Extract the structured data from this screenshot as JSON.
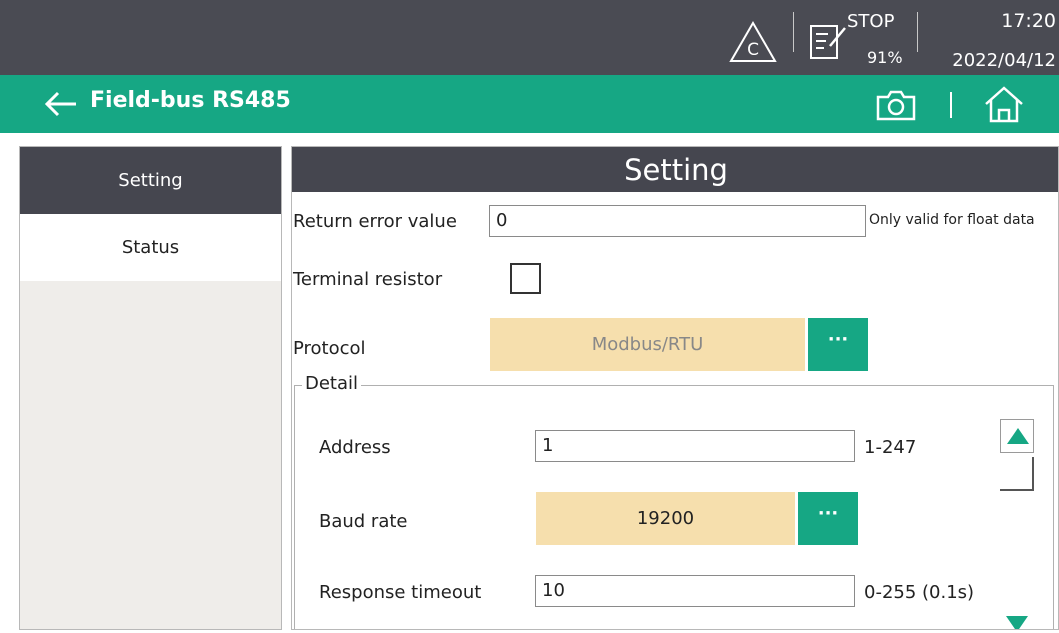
{
  "status_bar": {
    "state": "STOP",
    "battery": "91%",
    "time": "17:20",
    "date": "2022/04/12",
    "icons": [
      "alert-c-icon",
      "edit-note-icon"
    ]
  },
  "title_bar": {
    "title": "Field-bus RS485",
    "icons": [
      "back-arrow-icon",
      "camera-icon",
      "home-icon"
    ]
  },
  "sidebar": {
    "items": [
      {
        "label": "Setting",
        "selected": true
      },
      {
        "label": "Status",
        "selected": false
      }
    ]
  },
  "main": {
    "header": "Setting",
    "return_error": {
      "label": "Return error value",
      "value": "0",
      "hint": "Only valid for float data"
    },
    "terminal_resistor": {
      "label": "Terminal resistor",
      "checked": false
    },
    "protocol": {
      "label": "Protocol",
      "value": "Modbus/RTU",
      "more": "···"
    },
    "detail": {
      "title": "Detail",
      "address": {
        "label": "Address",
        "value": "1",
        "range": "1-247"
      },
      "baud_rate": {
        "label": "Baud rate",
        "value": "19200",
        "more": "···"
      },
      "response_timeout": {
        "label": "Response timeout",
        "value": "10",
        "range": "0-255 (0.1s)"
      }
    }
  },
  "colors": {
    "status_bar_bg": "#4a4b53",
    "accent_green": "#16a784",
    "header_dark": "#45464f",
    "select_bg": "#f6dfad",
    "sidebar_bg": "#efedea"
  }
}
